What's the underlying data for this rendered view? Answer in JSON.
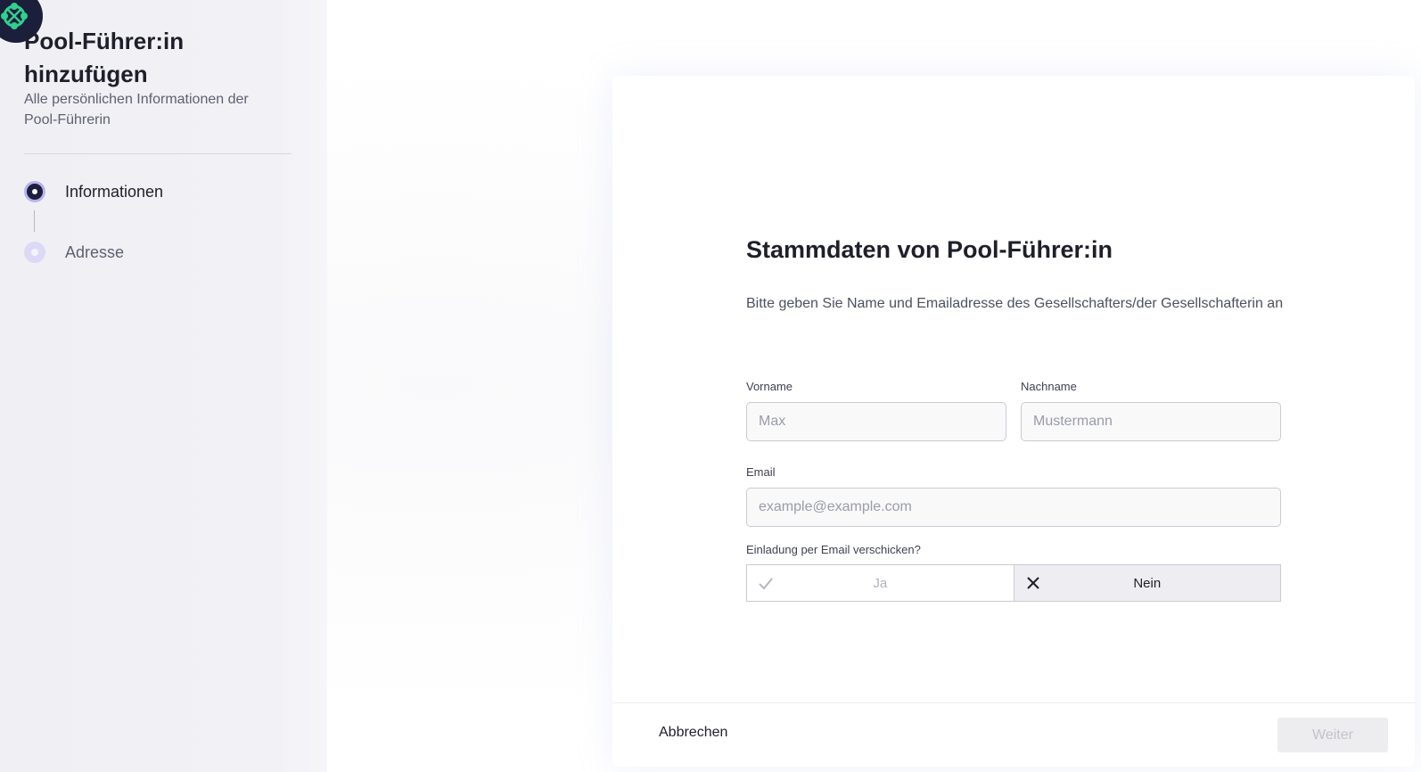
{
  "sidebar": {
    "title": "Pool-Führer:in hinzufügen",
    "subtitle": "Alle persönlichen Informationen der Pool-Führerin",
    "steps": [
      {
        "label": "Informationen",
        "state": "active"
      },
      {
        "label": "Adresse",
        "state": "inactive"
      }
    ]
  },
  "form": {
    "title": "Stammdaten von Pool-Führer:in",
    "description": "Bitte geben Sie Name und Emailadresse des Gesellschafters/der Gesellschafterin an",
    "first_name": {
      "label": "Vorname",
      "placeholder": "Max",
      "value": ""
    },
    "last_name": {
      "label": "Nachname",
      "placeholder": "Mustermann",
      "value": ""
    },
    "email": {
      "label": "Email",
      "placeholder": "example@example.com",
      "value": ""
    },
    "invite": {
      "label": "Einladung per Email verschicken?",
      "yes_label": "Ja",
      "no_label": "Nein",
      "selected": "Nein"
    }
  },
  "footer": {
    "cancel_label": "Abbrechen",
    "next_label": "Weiter"
  },
  "colors": {
    "brand_dark": "#1b1f3b",
    "step_accent": "#b9b2ee",
    "logo_green": "#2fd18f"
  },
  "icons": {
    "logo": "pool-logo-icon",
    "yes": "check-icon",
    "no": "close-icon"
  }
}
